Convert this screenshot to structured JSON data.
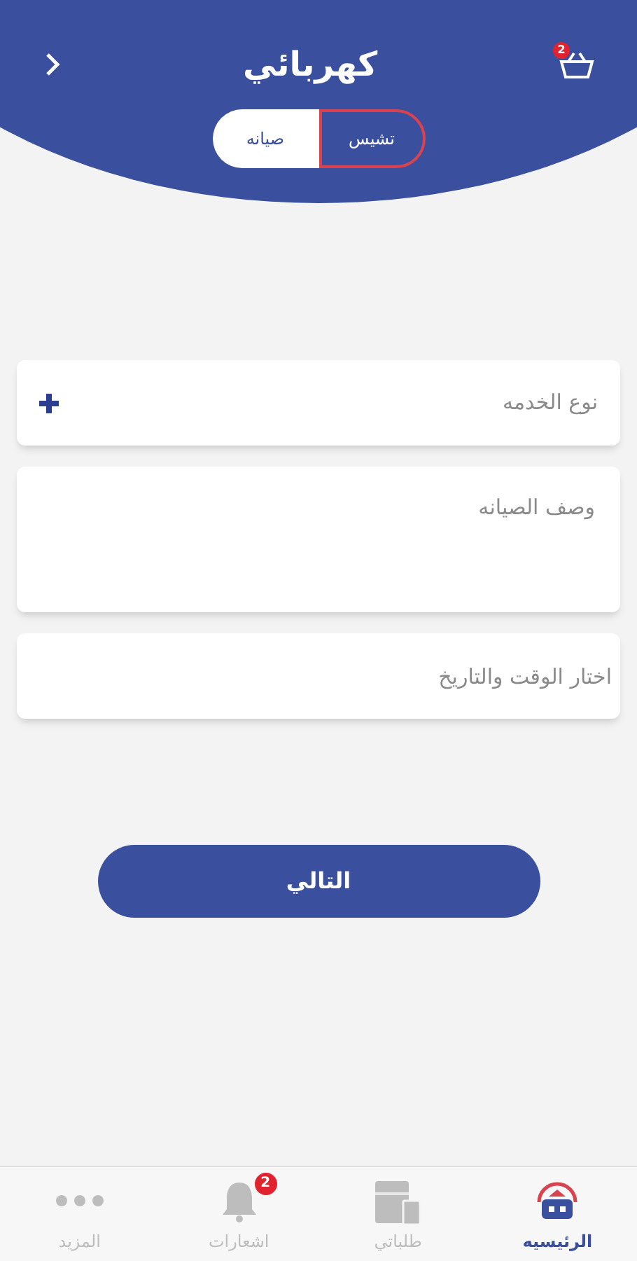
{
  "header": {
    "title": "كهربائي",
    "cart_badge": "2"
  },
  "tabs": [
    {
      "label": "تشيس",
      "selected": true
    },
    {
      "label": "صيانه",
      "selected": false
    }
  ],
  "fields": [
    {
      "kind": "select",
      "placeholder": "نوع الخدمه"
    },
    {
      "kind": "textarea",
      "placeholder": "وصف الصيانه"
    },
    {
      "kind": "picker",
      "placeholder": "اختار الوقت والتاريخ"
    }
  ],
  "next_button": "التالي",
  "bottom_nav": [
    {
      "kind": "home",
      "label": "الرئيسيه",
      "selected": true
    },
    {
      "kind": "orders",
      "label": "طلباتي",
      "selected": false
    },
    {
      "kind": "bell",
      "label": "اشعارات",
      "selected": false,
      "badge": "2"
    },
    {
      "kind": "more",
      "label": "المزيد",
      "selected": false
    }
  ]
}
